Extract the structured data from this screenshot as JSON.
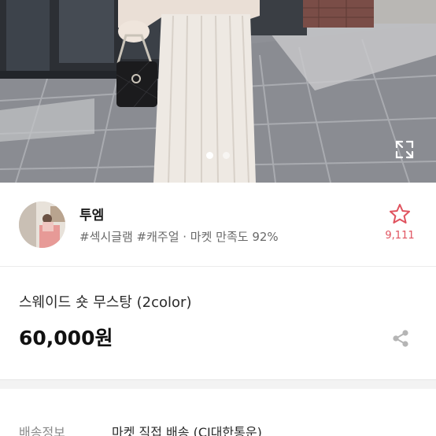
{
  "hero": {
    "image": "product-photo-woman-white-knit-skirt-black-quilted-bag",
    "slide_count": 2,
    "active_slide": 1,
    "expand_icon": "expand-arrows-icon"
  },
  "shop": {
    "name": "투엠",
    "tags": "#섹시글램 #캐주얼 · 마켓 만족도 92%",
    "favorite_count": "9,111",
    "favorite_icon": "star-outline-icon",
    "accent_color": "#e0535f"
  },
  "product": {
    "title": "스웨이드 숏 무스탕 (2color)",
    "price": "60,000원",
    "share_icon": "share-icon"
  },
  "shipping": {
    "label": "배송정보",
    "value": "마켓 직접 배송 (CJ대한통운)"
  }
}
